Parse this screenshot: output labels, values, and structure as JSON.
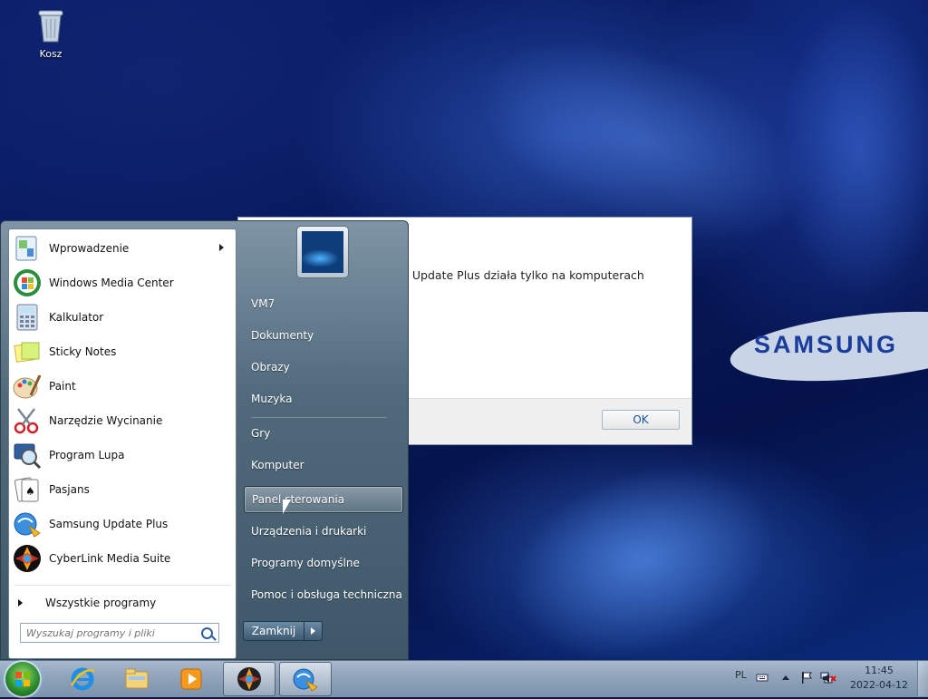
{
  "desktop": {
    "brand": "SAMSUNG",
    "icons": [
      {
        "label": "Kosz",
        "icon": "recycle-bin-icon"
      }
    ]
  },
  "dialog": {
    "message": "g Update Plus działa tylko na komputerach",
    "ok_label": "OK"
  },
  "start_menu": {
    "programs": [
      {
        "label": "Wprowadzenie",
        "icon": "getting-started-icon",
        "has_submenu": true
      },
      {
        "label": "Windows Media Center",
        "icon": "windows-media-center-icon"
      },
      {
        "label": "Kalkulator",
        "icon": "calculator-icon"
      },
      {
        "label": "Sticky Notes",
        "icon": "sticky-notes-icon"
      },
      {
        "label": "Paint",
        "icon": "paint-icon"
      },
      {
        "label": "Narzędzie Wycinanie",
        "icon": "snipping-tool-icon"
      },
      {
        "label": "Program Lupa",
        "icon": "magnifier-icon"
      },
      {
        "label": "Pasjans",
        "icon": "solitaire-icon"
      },
      {
        "label": "Samsung Update Plus",
        "icon": "samsung-update-icon"
      },
      {
        "label": "CyberLink Media Suite",
        "icon": "cyberlink-icon"
      }
    ],
    "all_programs": "Wszystkie programy",
    "search_placeholder": "Wyszukaj programy i pliki",
    "right_items": [
      {
        "label": "VM7"
      },
      {
        "label": "Dokumenty"
      },
      {
        "label": "Obrazy"
      },
      {
        "label": "Muzyka"
      },
      {
        "label": "Gry"
      },
      {
        "label": "Komputer"
      },
      {
        "label": "Panel sterowania",
        "selected": true
      },
      {
        "label": "Urządzenia i drukarki"
      },
      {
        "label": "Programy domyślne"
      },
      {
        "label": "Pomoc i obsługa techniczna"
      }
    ],
    "shutdown_label": "Zamknij"
  },
  "taskbar": {
    "pinned": [
      {
        "name": "internet-explorer-icon"
      },
      {
        "name": "file-explorer-icon"
      },
      {
        "name": "media-player-icon"
      },
      {
        "name": "cyberlink-icon",
        "active": true
      },
      {
        "name": "samsung-update-icon",
        "active": true
      }
    ],
    "language": "PL",
    "time": "11:45",
    "date": "2022-04-12"
  },
  "colors": {
    "accent": "#1a4f9c",
    "taskbar": "#8fa3ba",
    "desktop": "#07185a"
  }
}
